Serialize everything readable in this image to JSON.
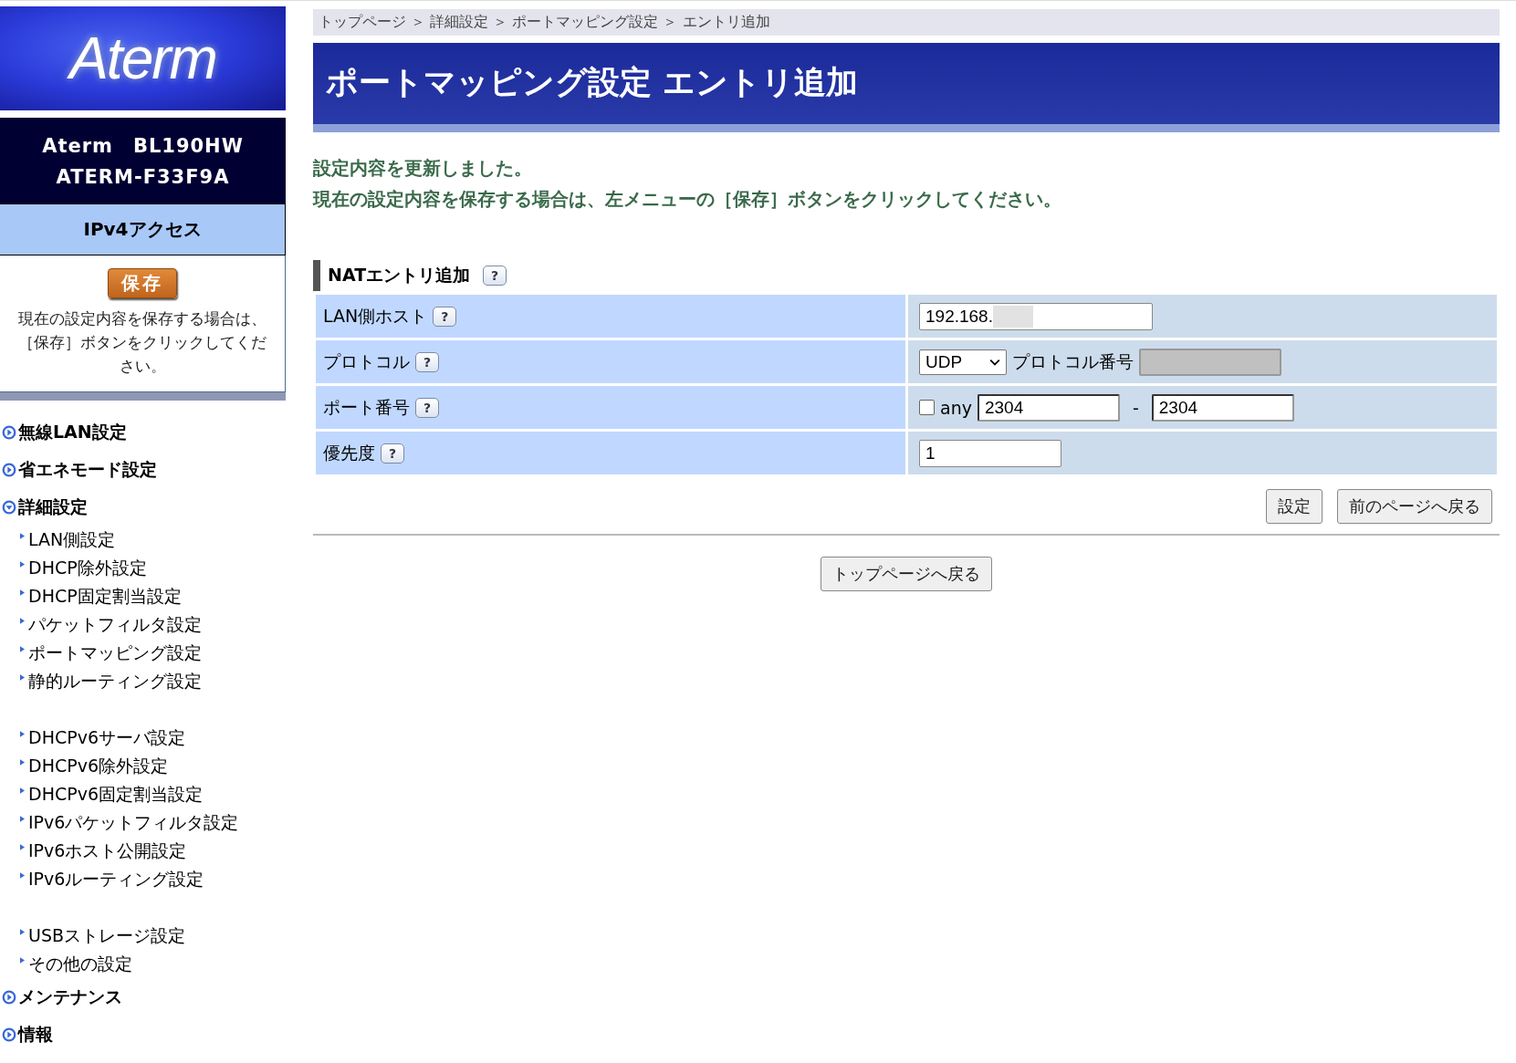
{
  "sidebar": {
    "logo": "Aterm",
    "model": [
      "Aterm　BL190HW",
      "ATERM-F33F9A"
    ],
    "mode": "IPv4アクセス",
    "save_button": "保存",
    "save_note": "現在の設定内容を保存する場合は、［保存］ボタンをクリックしてください。",
    "menu": [
      {
        "label": "無線LAN設定",
        "expanded": false
      },
      {
        "label": "省エネモード設定",
        "expanded": false
      },
      {
        "label": "詳細設定",
        "expanded": true,
        "groups": [
          [
            "LAN側設定",
            "DHCP除外設定",
            "DHCP固定割当設定",
            "パケットフィルタ設定",
            "ポートマッピング設定",
            "静的ルーティング設定"
          ],
          [
            "DHCPv6サーバ設定",
            "DHCPv6除外設定",
            "DHCPv6固定割当設定",
            "IPv6パケットフィルタ設定",
            "IPv6ホスト公開設定",
            "IPv6ルーティング設定"
          ],
          [
            "USBストレージ設定",
            "その他の設定"
          ]
        ]
      },
      {
        "label": "メンテナンス",
        "expanded": false
      },
      {
        "label": "情報",
        "expanded": false
      }
    ]
  },
  "breadcrumb": "トップページ ＞ 詳細設定 ＞ ポートマッピング設定 ＞ エントリ追加",
  "title": "ポートマッピング設定 エントリ追加",
  "messages": [
    "設定内容を更新しました。",
    "現在の設定内容を保存する場合は、左メニューの［保存］ボタンをクリックしてください。"
  ],
  "section": {
    "title": "NATエントリ追加",
    "help": "?"
  },
  "rows": [
    {
      "kind": "host",
      "label": "LAN側ホスト",
      "help": "?",
      "value": "192.168."
    },
    {
      "kind": "protocol",
      "label": "プロトコル",
      "help": "?",
      "select": "UDP",
      "number_label": "プロトコル番号",
      "number_disabled": true
    },
    {
      "kind": "port",
      "label": "ポート番号",
      "help": "?",
      "any_label": "any",
      "any_checked": false,
      "from": "2304",
      "separator": "-",
      "to": "2304"
    },
    {
      "kind": "priority",
      "label": "優先度",
      "help": "?",
      "value": "1"
    }
  ],
  "buttons": [
    "設定",
    "前のページへ戻る"
  ],
  "top_button": "トップページへ戻る"
}
